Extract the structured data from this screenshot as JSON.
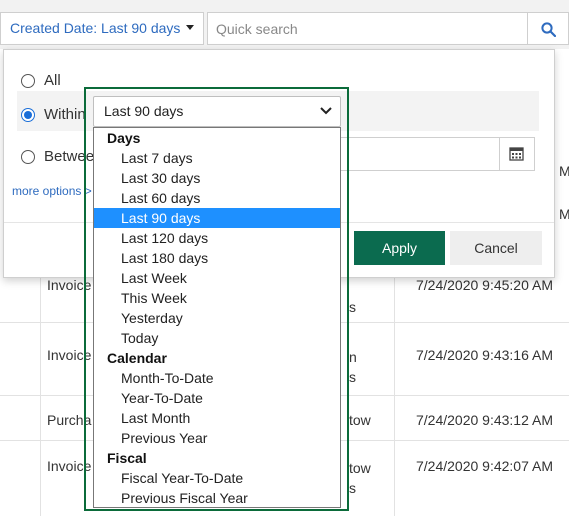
{
  "toolbar": {
    "filter_label": "Created Date: Last 90 days",
    "search_placeholder": "Quick search"
  },
  "grid": {
    "rows": [
      {
        "type": "Invoice",
        "status": "s",
        "date": "7/24/2020 9:45:20 AM"
      },
      {
        "type": "Invoice",
        "status": "n\ns",
        "date": "7/24/2020 9:43:16 AM"
      },
      {
        "type": "Purcha",
        "status": "tow",
        "date": "7/24/2020 9:43:12 AM"
      },
      {
        "type": "Invoice",
        "status": "tow\ns",
        "date": "7/24/2020 9:42:07 AM"
      }
    ],
    "partial_right": [
      "M",
      "M"
    ]
  },
  "panel": {
    "option_all": "All",
    "option_within": "Within",
    "option_between": "Betwee",
    "more_options": "more options >",
    "apply_label": "Apply",
    "cancel_label": "Cancel"
  },
  "dropdown": {
    "selected": "Last 90 days",
    "groups": [
      {
        "label": "Days",
        "items": [
          "Last 7 days",
          "Last 30 days",
          "Last 60 days",
          "Last 90 days",
          "Last 120 days",
          "Last 180 days",
          "Last Week",
          "This Week",
          "Yesterday",
          "Today"
        ]
      },
      {
        "label": "Calendar",
        "items": [
          "Month-To-Date",
          "Year-To-Date",
          "Last Month",
          "Previous Year"
        ]
      },
      {
        "label": "Fiscal",
        "items": [
          "Fiscal Year-To-Date",
          "Previous Fiscal Year"
        ]
      }
    ]
  },
  "colors": {
    "accent_blue": "#2e6bbf",
    "apply_green": "#0b6b4f",
    "highlight_green": "#0b6b3a",
    "selected_blue": "#1e90ff"
  }
}
